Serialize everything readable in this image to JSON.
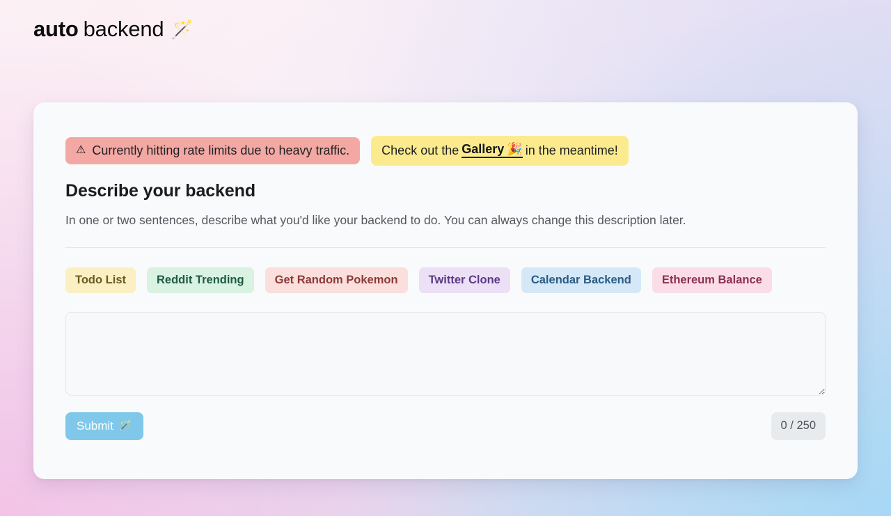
{
  "header": {
    "logo_bold": "auto",
    "logo_light": "backend",
    "logo_icon": "magic-wand-icon",
    "logo_emoji": "🪄"
  },
  "banners": {
    "warning": {
      "icon": "warning-triangle-icon",
      "icon_glyph": "⚠",
      "text": "Currently hitting rate limits due to heavy traffic.",
      "bg": "#f4a8a3",
      "fg": "#1f2023"
    },
    "gallery": {
      "prefix": "Check out the",
      "link_label": "Gallery",
      "link_icon": "party-popper-icon",
      "link_emoji": "🎉",
      "suffix": "in the meantime!",
      "bg": "#fbeb8e",
      "fg": "#1f2023"
    }
  },
  "form": {
    "title": "Describe your backend",
    "subtitle": "In one or two sentences, describe what you'd like your backend to do. You can always change this description later.",
    "textarea_value": "",
    "textarea_placeholder": "",
    "submit_label": "Submit",
    "submit_icon": "magic-wand-icon",
    "submit_emoji": "🪄",
    "submit_bg": "#7fc8ea",
    "char_counter": "0 / 250",
    "char_count": 0,
    "char_max": 250
  },
  "suggestions": [
    {
      "label": "Todo List",
      "bg": "#faf0c3",
      "fg": "#6b5b1e"
    },
    {
      "label": "Reddit Trending",
      "bg": "#d9f2e2",
      "fg": "#1f5a43"
    },
    {
      "label": "Get Random Pokemon",
      "bg": "#fadfdd",
      "fg": "#8a3b37"
    },
    {
      "label": "Twitter Clone",
      "bg": "#ece0f7",
      "fg": "#5d3a86"
    },
    {
      "label": "Calendar Backend",
      "bg": "#d5e8f7",
      "fg": "#2a5a85"
    },
    {
      "label": "Ethereum Balance",
      "bg": "#fadde7",
      "fg": "#8c2f52"
    }
  ]
}
